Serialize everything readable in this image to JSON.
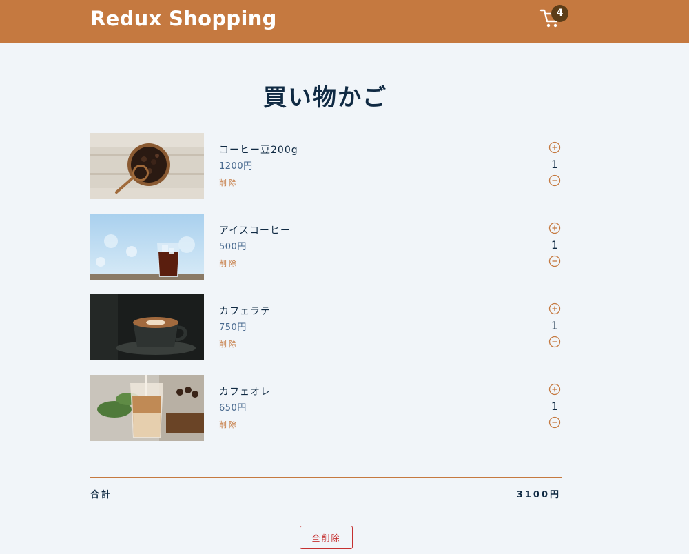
{
  "header": {
    "brand": "Redux Shopping",
    "cart_count": "4",
    "cart_icon": "shopping-cart-icon"
  },
  "page": {
    "title": "買い物かご"
  },
  "cart": {
    "items": [
      {
        "name": "コーヒー豆200g",
        "price": "1200円",
        "remove_label": "削除",
        "quantity": "1",
        "image": "coffee-beans-bowl"
      },
      {
        "name": "アイスコーヒー",
        "price": "500円",
        "remove_label": "削除",
        "quantity": "1",
        "image": "iced-coffee-glass"
      },
      {
        "name": "カフェラテ",
        "price": "750円",
        "remove_label": "削除",
        "quantity": "1",
        "image": "latte-cup"
      },
      {
        "name": "カフェオレ",
        "price": "650円",
        "remove_label": "削除",
        "quantity": "1",
        "image": "cafe-au-lait-glass"
      }
    ],
    "total_label": "合計",
    "total_amount": "3100円",
    "clear_label": "全削除"
  },
  "colors": {
    "accent": "#c57940",
    "background": "#f1f5f9",
    "text": "#102a43",
    "price": "#48698e",
    "danger": "#c53030"
  }
}
